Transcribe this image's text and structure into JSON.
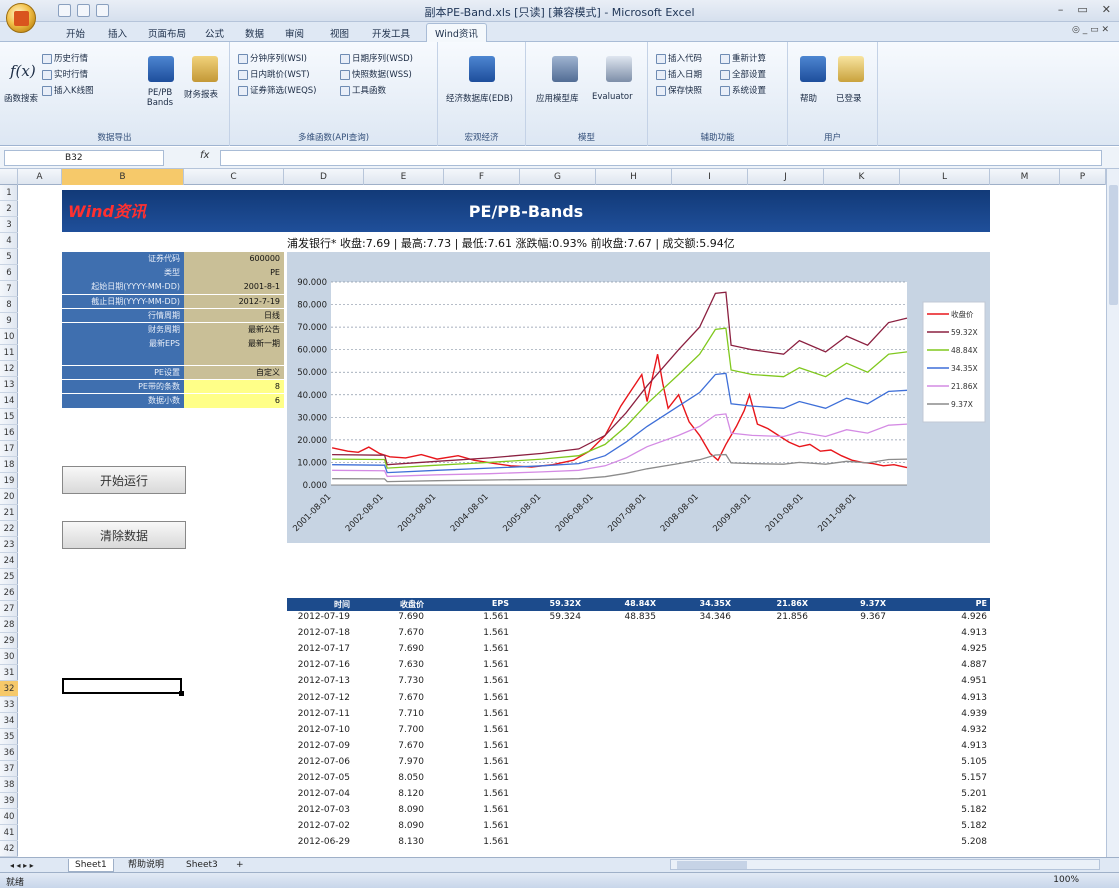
{
  "window": {
    "title": "副本PE-Band.xls [只读] [兼容模式] - Microsoft Excel",
    "controls": [
      "–",
      "▭",
      "✕"
    ]
  },
  "ribbon_tabs": [
    "开始",
    "插入",
    "页面布局",
    "公式",
    "数据",
    "审阅",
    "视图",
    "开发工具",
    "Wind资讯"
  ],
  "ribbon_tabs_active": 8,
  "help_controls": "◎ _ ▭ ✕",
  "ribbon": {
    "group_data_export": {
      "label": "数据导出",
      "fx_label": "函数搜索",
      "history": "历史行情",
      "realtime": "实时行情",
      "insert_chart": "插入K线图",
      "pepb": "PE/PB Bands",
      "finance": "财务报表"
    },
    "group_multi": {
      "label": "多维函数(API查询)",
      "items": [
        "分钟序列(WSI)",
        "日内跳价(WST)",
        "证券筛选(WEQS)",
        "日期序列(WSD)",
        "快照数据(WSS)",
        "工具函数"
      ]
    },
    "group_macro": {
      "label": "宏观经济",
      "item": "经济数据库(EDB)"
    },
    "group_model": {
      "label": "模型",
      "items": [
        "应用模型库",
        "Evaluator"
      ]
    },
    "group_aux": {
      "label": "辅助功能",
      "items": [
        "插入代码",
        "插入日期",
        "保存快照",
        "重新计算",
        "全部设置",
        "系统设置"
      ]
    },
    "group_user": {
      "label": "用户",
      "items": [
        "帮助",
        "已登录"
      ]
    }
  },
  "formula_bar": {
    "name_box": "B32",
    "fx": "fx"
  },
  "columns": [
    "A",
    "B",
    "C",
    "D",
    "E",
    "F",
    "G",
    "H",
    "I",
    "J",
    "K",
    "L",
    "M",
    "N",
    "P"
  ],
  "selected_column": "B",
  "rows": [
    "1",
    "2",
    "3",
    "4",
    "5",
    "6",
    "7",
    "8",
    "9",
    "10",
    "11",
    "12",
    "13",
    "14",
    "15",
    "16",
    "17",
    "18",
    "19",
    "20",
    "21",
    "22",
    "23",
    "24",
    "25",
    "26",
    "27",
    "28",
    "29",
    "30",
    "31",
    "32",
    "33",
    "34",
    "35",
    "36",
    "37",
    "38",
    "39",
    "40",
    "41",
    "42"
  ],
  "selected_row": "32",
  "banner": {
    "logo": "Wind资讯",
    "title": "PE/PB-Bands"
  },
  "quote_line": "浦发银行*    收盘:7.69 | 最高:7.73 | 最低:7.61  涨跌幅:0.93%  前收盘:7.67 | 成交额:5.94亿",
  "params": [
    {
      "label": "证券代码",
      "value": "600000",
      "highlight": false
    },
    {
      "label": "类型",
      "value": "PE",
      "highlight": false
    },
    {
      "label": "起始日期(YYYY-MM-DD)",
      "value": "2001-8-1",
      "highlight": false
    },
    {
      "label": "截止日期(YYYY-MM-DD)",
      "value": "2012-7-19",
      "highlight": false
    },
    {
      "label": "行情周期",
      "value": "日线",
      "highlight": false
    },
    {
      "label": "财务周期",
      "value": "最新公告",
      "highlight": false
    },
    {
      "label": "最新EPS",
      "value": "最新一期",
      "highlight": false
    },
    {
      "label": "",
      "value": "",
      "highlight": false
    },
    {
      "label": "PE设置",
      "value": "自定义",
      "highlight": false
    },
    {
      "label": "PE带的条数",
      "value": "8",
      "highlight": true
    },
    {
      "label": "数据小数",
      "value": "6",
      "highlight": true
    }
  ],
  "buttons": {
    "run": "开始运行",
    "clear": "清除数据"
  },
  "chart_data": {
    "type": "line",
    "title": "",
    "x_tick_labels": [
      "2001-08-01",
      "2002-08-01",
      "2003-08-01",
      "2004-08-01",
      "2005-08-01",
      "2006-08-01",
      "2007-08-01",
      "2008-08-01",
      "2009-08-01",
      "2010-08-01",
      "2011-08-01"
    ],
    "y_tick_labels": [
      "0.000",
      "10.000",
      "20.000",
      "30.000",
      "40.000",
      "50.000",
      "60.000",
      "70.000",
      "80.000",
      "90.000"
    ],
    "ylim": [
      0,
      90
    ],
    "x_range": [
      2001.58,
      2012.55
    ],
    "grid": true,
    "legend_position": "right",
    "series": [
      {
        "name": "收盘价",
        "color": "#e8161b",
        "points": [
          [
            2001.6,
            16.5
          ],
          [
            2001.9,
            15.0
          ],
          [
            2002.1,
            14.5
          ],
          [
            2002.3,
            16.8
          ],
          [
            2002.5,
            14.0
          ],
          [
            2002.7,
            12.5
          ],
          [
            2003.0,
            12.0
          ],
          [
            2003.3,
            13.5
          ],
          [
            2003.6,
            11.5
          ],
          [
            2004.0,
            13.0
          ],
          [
            2004.3,
            11.0
          ],
          [
            2004.7,
            9.5
          ],
          [
            2005.0,
            8.5
          ],
          [
            2005.4,
            8.0
          ],
          [
            2005.8,
            9.0
          ],
          [
            2006.2,
            11.0
          ],
          [
            2006.5,
            15.0
          ],
          [
            2006.8,
            22.0
          ],
          [
            2007.1,
            35.0
          ],
          [
            2007.3,
            42.0
          ],
          [
            2007.5,
            49.0
          ],
          [
            2007.6,
            37.0
          ],
          [
            2007.8,
            58.0
          ],
          [
            2007.9,
            45.0
          ],
          [
            2008.0,
            34.0
          ],
          [
            2008.2,
            40.0
          ],
          [
            2008.4,
            28.0
          ],
          [
            2008.6,
            22.0
          ],
          [
            2008.8,
            14.0
          ],
          [
            2008.95,
            11.0
          ],
          [
            2009.1,
            18.0
          ],
          [
            2009.3,
            26.0
          ],
          [
            2009.45,
            33.0
          ],
          [
            2009.55,
            40.0
          ],
          [
            2009.7,
            27.0
          ],
          [
            2009.9,
            25.0
          ],
          [
            2010.1,
            22.0
          ],
          [
            2010.3,
            19.0
          ],
          [
            2010.5,
            17.0
          ],
          [
            2010.7,
            18.0
          ],
          [
            2010.9,
            15.0
          ],
          [
            2011.1,
            15.5
          ],
          [
            2011.3,
            13.0
          ],
          [
            2011.5,
            11.0
          ],
          [
            2011.7,
            10.0
          ],
          [
            2011.9,
            9.5
          ],
          [
            2012.1,
            8.5
          ],
          [
            2012.3,
            9.0
          ],
          [
            2012.55,
            7.7
          ]
        ]
      },
      {
        "name": "59.32X",
        "color": "#8b2040",
        "points": [
          [
            2001.6,
            13.5
          ],
          [
            2002.6,
            13.2
          ],
          [
            2002.65,
            9.0
          ],
          [
            2003.6,
            10.5
          ],
          [
            2004.6,
            12.0
          ],
          [
            2005.6,
            14.0
          ],
          [
            2006.3,
            16.0
          ],
          [
            2006.8,
            22.0
          ],
          [
            2007.2,
            32.0
          ],
          [
            2007.6,
            44.0
          ],
          [
            2008.2,
            60.0
          ],
          [
            2008.6,
            70.0
          ],
          [
            2008.9,
            85.0
          ],
          [
            2009.1,
            85.5
          ],
          [
            2009.2,
            62.0
          ],
          [
            2009.6,
            60.0
          ],
          [
            2010.2,
            58.0
          ],
          [
            2010.5,
            64.0
          ],
          [
            2011.0,
            59.0
          ],
          [
            2011.4,
            66.0
          ],
          [
            2011.8,
            62.0
          ],
          [
            2012.2,
            72.0
          ],
          [
            2012.55,
            74.0
          ]
        ]
      },
      {
        "name": "48.84X",
        "color": "#80c81e",
        "points": [
          [
            2001.6,
            11.5
          ],
          [
            2002.6,
            11.3
          ],
          [
            2002.65,
            7.5
          ],
          [
            2003.6,
            8.8
          ],
          [
            2004.6,
            10.0
          ],
          [
            2005.6,
            11.5
          ],
          [
            2006.3,
            13.0
          ],
          [
            2006.8,
            18.0
          ],
          [
            2007.2,
            26.0
          ],
          [
            2007.6,
            36.0
          ],
          [
            2008.2,
            49.0
          ],
          [
            2008.6,
            58.0
          ],
          [
            2008.9,
            69.0
          ],
          [
            2009.1,
            69.5
          ],
          [
            2009.2,
            51.0
          ],
          [
            2009.6,
            49.0
          ],
          [
            2010.2,
            48.0
          ],
          [
            2010.5,
            52.0
          ],
          [
            2011.0,
            48.0
          ],
          [
            2011.4,
            54.0
          ],
          [
            2011.8,
            50.0
          ],
          [
            2012.2,
            58.0
          ],
          [
            2012.55,
            59.0
          ]
        ]
      },
      {
        "name": "34.35X",
        "color": "#3e6fd8",
        "points": [
          [
            2001.6,
            9.0
          ],
          [
            2002.6,
            8.8
          ],
          [
            2002.65,
            5.5
          ],
          [
            2003.6,
            6.5
          ],
          [
            2004.6,
            7.5
          ],
          [
            2005.6,
            8.5
          ],
          [
            2006.3,
            9.5
          ],
          [
            2006.8,
            13.0
          ],
          [
            2007.2,
            19.0
          ],
          [
            2007.6,
            26.0
          ],
          [
            2008.2,
            35.0
          ],
          [
            2008.6,
            41.0
          ],
          [
            2008.9,
            49.0
          ],
          [
            2009.1,
            49.5
          ],
          [
            2009.2,
            36.0
          ],
          [
            2009.6,
            35.0
          ],
          [
            2010.2,
            34.0
          ],
          [
            2010.5,
            37.0
          ],
          [
            2011.0,
            34.0
          ],
          [
            2011.4,
            38.5
          ],
          [
            2011.8,
            36.0
          ],
          [
            2012.2,
            41.5
          ],
          [
            2012.55,
            42.0
          ]
        ]
      },
      {
        "name": "21.86X",
        "color": "#d48be4",
        "points": [
          [
            2001.6,
            6.5
          ],
          [
            2002.6,
            6.3
          ],
          [
            2002.65,
            3.8
          ],
          [
            2003.6,
            4.5
          ],
          [
            2004.6,
            5.0
          ],
          [
            2005.6,
            5.8
          ],
          [
            2006.3,
            6.5
          ],
          [
            2006.8,
            8.5
          ],
          [
            2007.2,
            12.0
          ],
          [
            2007.6,
            17.0
          ],
          [
            2008.2,
            22.0
          ],
          [
            2008.6,
            26.0
          ],
          [
            2008.9,
            31.0
          ],
          [
            2009.1,
            31.5
          ],
          [
            2009.2,
            23.0
          ],
          [
            2009.6,
            22.0
          ],
          [
            2010.2,
            21.5
          ],
          [
            2010.5,
            23.5
          ],
          [
            2011.0,
            21.5
          ],
          [
            2011.4,
            24.5
          ],
          [
            2011.8,
            23.0
          ],
          [
            2012.2,
            26.5
          ],
          [
            2012.55,
            27.0
          ]
        ]
      },
      {
        "name": "9.37X",
        "color": "#8c8c8c",
        "points": [
          [
            2001.6,
            2.8
          ],
          [
            2002.6,
            2.7
          ],
          [
            2002.65,
            1.5
          ],
          [
            2003.6,
            1.9
          ],
          [
            2004.6,
            2.2
          ],
          [
            2005.6,
            2.5
          ],
          [
            2006.3,
            2.8
          ],
          [
            2006.8,
            3.7
          ],
          [
            2007.2,
            5.2
          ],
          [
            2007.6,
            7.2
          ],
          [
            2008.2,
            9.5
          ],
          [
            2008.6,
            11.2
          ],
          [
            2008.9,
            13.3
          ],
          [
            2009.1,
            13.5
          ],
          [
            2009.2,
            9.8
          ],
          [
            2009.6,
            9.5
          ],
          [
            2010.2,
            9.2
          ],
          [
            2010.5,
            10.0
          ],
          [
            2011.0,
            9.2
          ],
          [
            2011.4,
            10.5
          ],
          [
            2011.8,
            9.8
          ],
          [
            2012.2,
            11.3
          ],
          [
            2012.55,
            11.5
          ]
        ]
      }
    ],
    "legend_labels": [
      "收盘价",
      "59.32X",
      "48.84X",
      "34.35X",
      "21.86X",
      "9.37X"
    ]
  },
  "table": {
    "headers": [
      "时间",
      "收盘价",
      "EPS",
      "59.32X",
      "48.84X",
      "34.35X",
      "21.86X",
      "9.37X",
      "PE"
    ],
    "rows": [
      [
        "2012-07-19",
        "7.690",
        "1.561",
        "59.324",
        "48.835",
        "34.346",
        "21.856",
        "9.367",
        "4.926"
      ],
      [
        "2012-07-18",
        "7.670",
        "1.561",
        "",
        "",
        "",
        "",
        "",
        "4.913"
      ],
      [
        "2012-07-17",
        "7.690",
        "1.561",
        "",
        "",
        "",
        "",
        "",
        "4.925"
      ],
      [
        "2012-07-16",
        "7.630",
        "1.561",
        "",
        "",
        "",
        "",
        "",
        "4.887"
      ],
      [
        "2012-07-13",
        "7.730",
        "1.561",
        "",
        "",
        "",
        "",
        "",
        "4.951"
      ],
      [
        "2012-07-12",
        "7.670",
        "1.561",
        "",
        "",
        "",
        "",
        "",
        "4.913"
      ],
      [
        "2012-07-11",
        "7.710",
        "1.561",
        "",
        "",
        "",
        "",
        "",
        "4.939"
      ],
      [
        "2012-07-10",
        "7.700",
        "1.561",
        "",
        "",
        "",
        "",
        "",
        "4.932"
      ],
      [
        "2012-07-09",
        "7.670",
        "1.561",
        "",
        "",
        "",
        "",
        "",
        "4.913"
      ],
      [
        "2012-07-06",
        "7.970",
        "1.561",
        "",
        "",
        "",
        "",
        "",
        "5.105"
      ],
      [
        "2012-07-05",
        "8.050",
        "1.561",
        "",
        "",
        "",
        "",
        "",
        "5.157"
      ],
      [
        "2012-07-04",
        "8.120",
        "1.561",
        "",
        "",
        "",
        "",
        "",
        "5.201"
      ],
      [
        "2012-07-03",
        "8.090",
        "1.561",
        "",
        "",
        "",
        "",
        "",
        "5.182"
      ],
      [
        "2012-07-02",
        "8.090",
        "1.561",
        "",
        "",
        "",
        "",
        "",
        "5.182"
      ],
      [
        "2012-06-29",
        "8.130",
        "1.561",
        "",
        "",
        "",
        "",
        "",
        "5.208"
      ]
    ]
  },
  "sheet_tabs": [
    "Sheet1",
    "帮助说明",
    "Sheet3"
  ],
  "sheet_tab_active": 0,
  "status": {
    "ready": "就绪",
    "zoom": "100%"
  }
}
